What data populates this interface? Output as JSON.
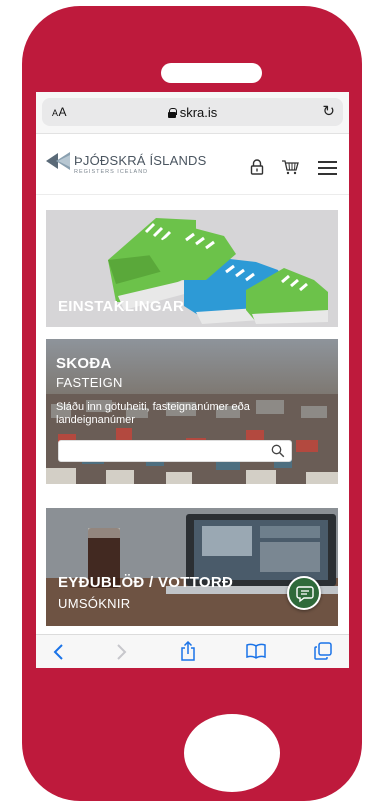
{
  "browser": {
    "text_size_label_small": "A",
    "text_size_label_large": "A",
    "url": "skra.is"
  },
  "site": {
    "logo_title": "ÞJÓÐSKRÁ ÍSLANDS",
    "logo_subtitle": "REGISTERS ICELAND"
  },
  "cards": {
    "einstaklingar": {
      "title": "EINSTAKLINGAR"
    },
    "skoda": {
      "title": "SKOÐA",
      "subtitle": "FASTEIGN",
      "description": "Sláðu inn götuheiti, fasteignanúmer eða landeignanúmer",
      "search_value": ""
    },
    "eydublod": {
      "title": "EYÐUBLÖÐ / VOTTORÐ",
      "subtitle": "UMSÓKNIR"
    }
  },
  "colors": {
    "phone_body": "#be1a3c",
    "safari_blue": "#1a73e8",
    "chat_green": "#2f6a3a",
    "shoe_green": "#6cc24a",
    "shoe_blue": "#2d9ad6"
  },
  "icons": [
    "lock-icon",
    "reload-icon",
    "padlock-icon",
    "cart-icon",
    "menu-icon",
    "search-icon",
    "chat-icon",
    "back-icon",
    "forward-icon",
    "share-icon",
    "bookmarks-icon",
    "tabs-icon"
  ]
}
